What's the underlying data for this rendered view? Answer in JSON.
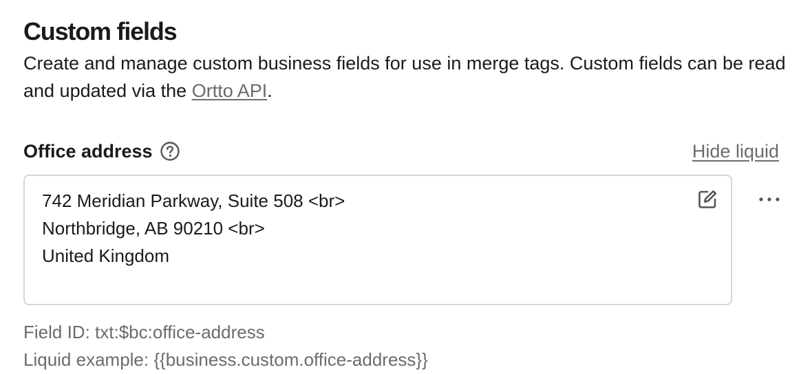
{
  "section": {
    "title": "Custom fields",
    "description_before_link": "Create and manage custom business fields for use in merge tags. Custom fields can be read and updated via the ",
    "description_link": "Ortto API",
    "description_after_link": "."
  },
  "field": {
    "label": "Office address",
    "hide_liquid_label": "Hide liquid",
    "value_lines": [
      "742 Meridian Parkway, Suite 508 <br>",
      "Northbridge, AB 90210 <br>",
      "United Kingdom"
    ],
    "field_id_label": "Field ID:",
    "field_id": "txt:$bc:office-address",
    "liquid_example_label": "Liquid example:",
    "liquid_example": "{{business.custom.office-address}}"
  },
  "icons": {
    "help": "question-circle-icon",
    "edit": "edit-square-icon",
    "more": "more-horizontal-icon"
  },
  "colors": {
    "text": "#1a1a1a",
    "muted": "#6b6b6b",
    "border": "#d6d6d6"
  }
}
